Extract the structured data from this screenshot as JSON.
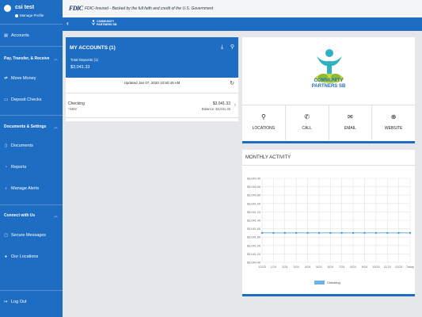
{
  "sidebar": {
    "user_name": "csi test",
    "manage_profile": "Manage Profile",
    "accounts": "Accounts",
    "section_pay": "Pay, Transfer, & Receive",
    "move_money": "Move Money",
    "deposit_checks": "Deposit Checks",
    "section_docs": "Documents & Settings",
    "documents": "Documents",
    "reports": "Reports",
    "manage_alerts": "Manage Alerts",
    "section_connect": "Connect with Us",
    "secure_messages": "Secure Messages",
    "our_locations": "Our Locations",
    "log_out": "Log Out"
  },
  "fdic": {
    "logo": "FDIC",
    "text": "FDIC-Insured - Backed by the full faith and credit of the U.S. Government"
  },
  "topbar": {
    "back": "‹",
    "brand_line1": "COMMUNITY",
    "brand_line2": "PARTNERS SB"
  },
  "accounts": {
    "title": "MY ACCOUNTS (1)",
    "total_label": "Total Deposits (1)",
    "total_amount": "$3,041.33",
    "updated": "Updated Jan 07, 2020 10:50:49 AM",
    "rows": [
      {
        "name": "Checking",
        "id": "*4462",
        "amount": "$3,041.33",
        "balance": "Balance: $3,041.33"
      }
    ]
  },
  "brand_card": {
    "logo_line1": "COMMUNITY",
    "logo_line2": "PARTNERS SB",
    "actions": [
      {
        "label": "LOCATIONS",
        "icon": "location-pin-icon"
      },
      {
        "label": "CALL",
        "icon": "phone-icon"
      },
      {
        "label": "EMAIL",
        "icon": "email-icon"
      },
      {
        "label": "WEBSITE",
        "icon": "globe-icon"
      }
    ]
  },
  "activity": {
    "title": "MONTHLY ACTIVITY"
  },
  "chart_data": {
    "type": "line",
    "categories": [
      "12/23",
      "1/24",
      "2/24",
      "3/24",
      "4/24",
      "5/24",
      "6/24",
      "7/24",
      "8/24",
      "9/24",
      "10/24",
      "11/24",
      "12/24",
      "Today"
    ],
    "y_tick_labels": [
      "$3,040.40",
      "$3,040.60",
      "$3,040.80",
      "$3,041.00",
      "$3,041.20",
      "$3,041.40",
      "$3,041.60",
      "$3,041.80",
      "$3,041.00",
      "$3,041.20",
      "$3,040.40"
    ],
    "series": [
      {
        "name": "Checking",
        "values": [
          3041.33,
          3041.33,
          3041.33,
          3041.33,
          3041.33,
          3041.33,
          3041.33,
          3041.33,
          3041.33,
          3041.33,
          3041.33,
          3041.33,
          3041.33,
          3041.33
        ]
      }
    ],
    "grid": true,
    "legend_position": "bottom",
    "series_color": "#3a8fd9"
  }
}
